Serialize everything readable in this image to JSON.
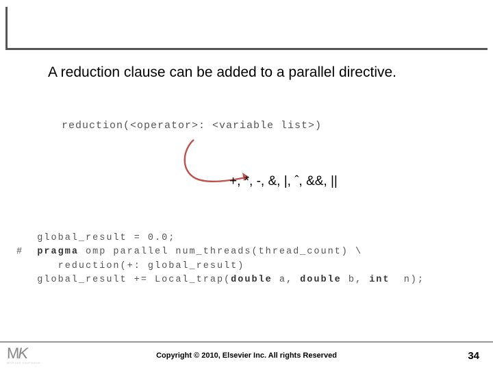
{
  "title_text": "A reduction clause can be added to a parallel directive.",
  "code_syntax": "reduction(<operator>: <variable list>)",
  "operator_list": "+, *, -, &, |, ˆ, &&, ||",
  "code_example": {
    "line1_a": "   global_result = 0.0;",
    "line2_a": "#  ",
    "line2_b": "pragma",
    "line2_c": " omp parallel num_threads(thread_count) \\",
    "line3_a": "      reduction(+: global_result)",
    "line4_a": "   global_result += Local_trap(",
    "line4_b": "double",
    "line4_c": " a, ",
    "line4_d": "double",
    "line4_e": " b, ",
    "line4_f": "int",
    "line4_g": "  n);"
  },
  "logo_main": "MK",
  "logo_sub": "MORGAN KAUFMANN",
  "copyright": "Copyright © 2010, Elsevier Inc. All rights Reserved",
  "slide_number": "34"
}
